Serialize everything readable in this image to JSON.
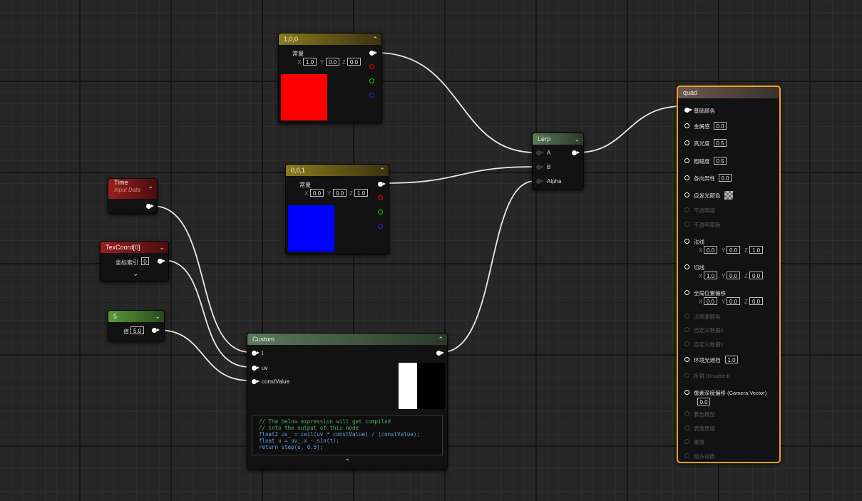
{
  "nodes": {
    "const_red": {
      "title": "1,0,0",
      "label": "常量",
      "x": "1.0",
      "y": "0.0",
      "z": "0.0",
      "ax_x": "X",
      "ax_y": "Y",
      "ax_z": "Z",
      "preview_color": "#ff0000"
    },
    "const_blue": {
      "title": "0,0,1",
      "label": "常量",
      "x": "0.0",
      "y": "0.0",
      "z": "1.0",
      "ax_x": "X",
      "ax_y": "Y",
      "ax_z": "Z",
      "preview_color": "#0000ff"
    },
    "time": {
      "title": "Time",
      "subtitle": "Input Data"
    },
    "texcoord": {
      "title": "TexCoord[0]",
      "label": "坐标索引",
      "value": "0"
    },
    "scalar": {
      "title": "5",
      "label": "值",
      "value": "5.0"
    },
    "lerp": {
      "title": "Lerp",
      "inputs": [
        "A",
        "B",
        "Alpha"
      ]
    },
    "custom": {
      "title": "Custom",
      "inputs": [
        "t",
        "uv",
        "constValue"
      ],
      "code": [
        "// The below expression will get compiled",
        "// into the output of this node",
        "float2 uv_ = ceil(uv * constValue) / (constValue);",
        "float u = uv_.x - sin(t);",
        "return step(u, 0.5);"
      ]
    },
    "quad": {
      "title": "quad",
      "pins": [
        {
          "label": "基础颜色",
          "active": true
        },
        {
          "label": "金属感",
          "active": true,
          "value": "0.0"
        },
        {
          "label": "高光度",
          "active": true,
          "value": "0.5"
        },
        {
          "label": "粗糙度",
          "active": true,
          "value": "0.5"
        },
        {
          "label": "各向异性",
          "active": true,
          "value": "0.0"
        },
        {
          "label": "自发光颜色",
          "active": true
        },
        {
          "label": "不透明度",
          "active": false
        },
        {
          "label": "不透明蒙版",
          "active": false
        },
        {
          "label": "法线",
          "active": true,
          "x": "0.0",
          "y": "0.0",
          "z": "1.0"
        },
        {
          "label": "切线",
          "active": true,
          "x": "1.0",
          "y": "0.0",
          "z": "0.0"
        },
        {
          "label": "全局位置偏移",
          "active": true,
          "x": "0.0",
          "y": "0.0",
          "z": "0.0"
        },
        {
          "label": "次表面颜色",
          "active": false
        },
        {
          "label": "自定义数据0",
          "active": false
        },
        {
          "label": "自定义数据1",
          "active": false
        },
        {
          "label": "环境光遮挡",
          "active": true,
          "value": "1.0"
        },
        {
          "label": "折射 (Disabled)",
          "active": false
        },
        {
          "label": "像素深度偏移 (Camera Vector)",
          "active": true,
          "value": "0.0"
        },
        {
          "label": "着色模型",
          "active": false
        },
        {
          "label": "表面厚度",
          "active": false
        },
        {
          "label": "置换",
          "active": false
        },
        {
          "label": "前方材质",
          "active": false
        }
      ]
    }
  },
  "colors": {
    "wire": "#e8e8e8",
    "selected_border": "#f0a020",
    "vector_header": "#7a6a1a",
    "time_header": "#8a1a1a",
    "scalar_header": "#4a7a2a",
    "math_header": "#4a6a4a"
  }
}
